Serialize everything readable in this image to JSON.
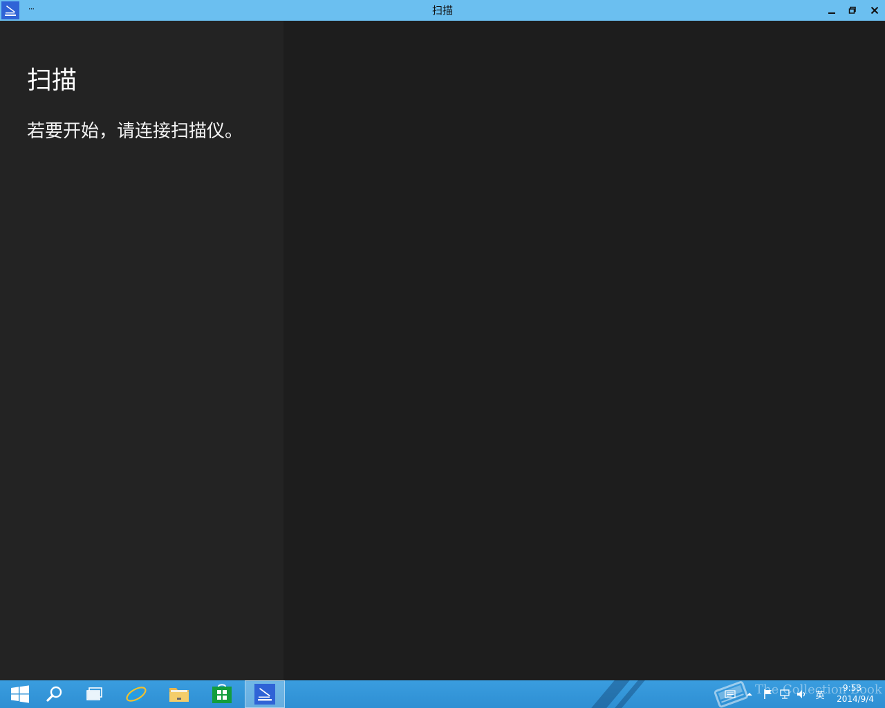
{
  "window": {
    "title": "扫描",
    "more_label": "···",
    "app_icon": "scanner-icon",
    "controls": [
      "minimize-icon",
      "restore-icon",
      "close-icon"
    ]
  },
  "pane": {
    "title": "扫描",
    "message": "若要开始，请连接扫描仪。"
  },
  "taskbar": {
    "items": [
      {
        "name": "start-button",
        "icon": "windows-logo-icon"
      },
      {
        "name": "search-button",
        "icon": "search-icon"
      },
      {
        "name": "task-view-button",
        "icon": "task-view-icon"
      },
      {
        "name": "internet-explorer-button",
        "icon": "internet-explorer-icon"
      },
      {
        "name": "file-explorer-button",
        "icon": "folder-icon"
      },
      {
        "name": "store-button",
        "icon": "store-icon"
      },
      {
        "name": "scan-app-button",
        "icon": "scanner-icon"
      }
    ],
    "tray": {
      "ime_label": "英",
      "time": "9:53",
      "date": "2014/9/4"
    },
    "watermark": "The Collection Book"
  },
  "colors": {
    "titlebar": "#6bbff0",
    "left_pane": "#232323",
    "right_pane": "#1d1d1d",
    "taskbar": "#3399dd",
    "app_icon": "#2f63d6"
  }
}
